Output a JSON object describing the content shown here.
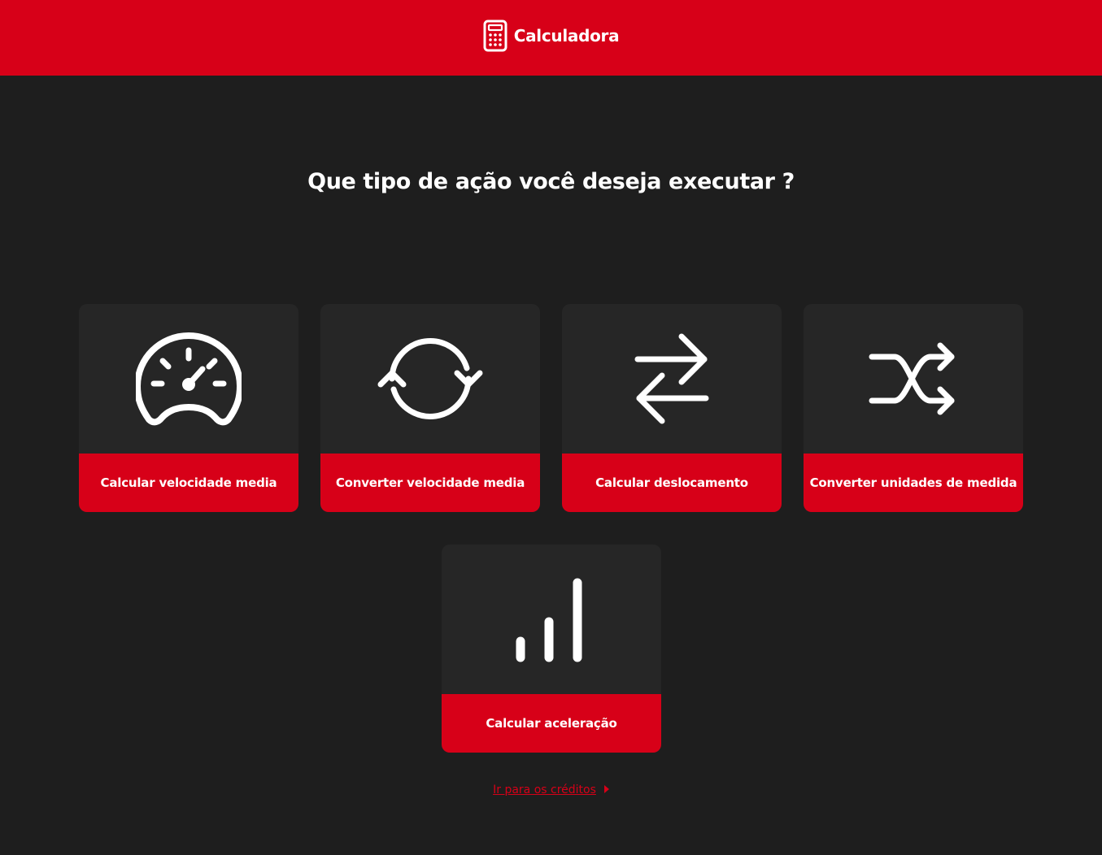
{
  "header": {
    "title": "Calculadora",
    "icon": "calculator-icon",
    "brand_color": "#d70018"
  },
  "question": "Que tipo de ação você deseja executar ?",
  "cards": [
    {
      "label": "Calcular velocidade media",
      "icon": "speedometer-icon"
    },
    {
      "label": "Converter velocidade media",
      "icon": "refresh-icon"
    },
    {
      "label": "Calcular deslocamento",
      "icon": "swap-arrows-icon"
    },
    {
      "label": "Converter unidades de medida",
      "icon": "shuffle-icon"
    },
    {
      "label": "Calcular aceleração",
      "icon": "signal-bars-icon"
    }
  ],
  "credits": {
    "link_text": "Ir para os créditos",
    "icon": "caret-right-icon"
  },
  "colors": {
    "background": "#1e1e1e",
    "card": "#262626",
    "accent": "#d70018",
    "text": "#ffffff"
  }
}
